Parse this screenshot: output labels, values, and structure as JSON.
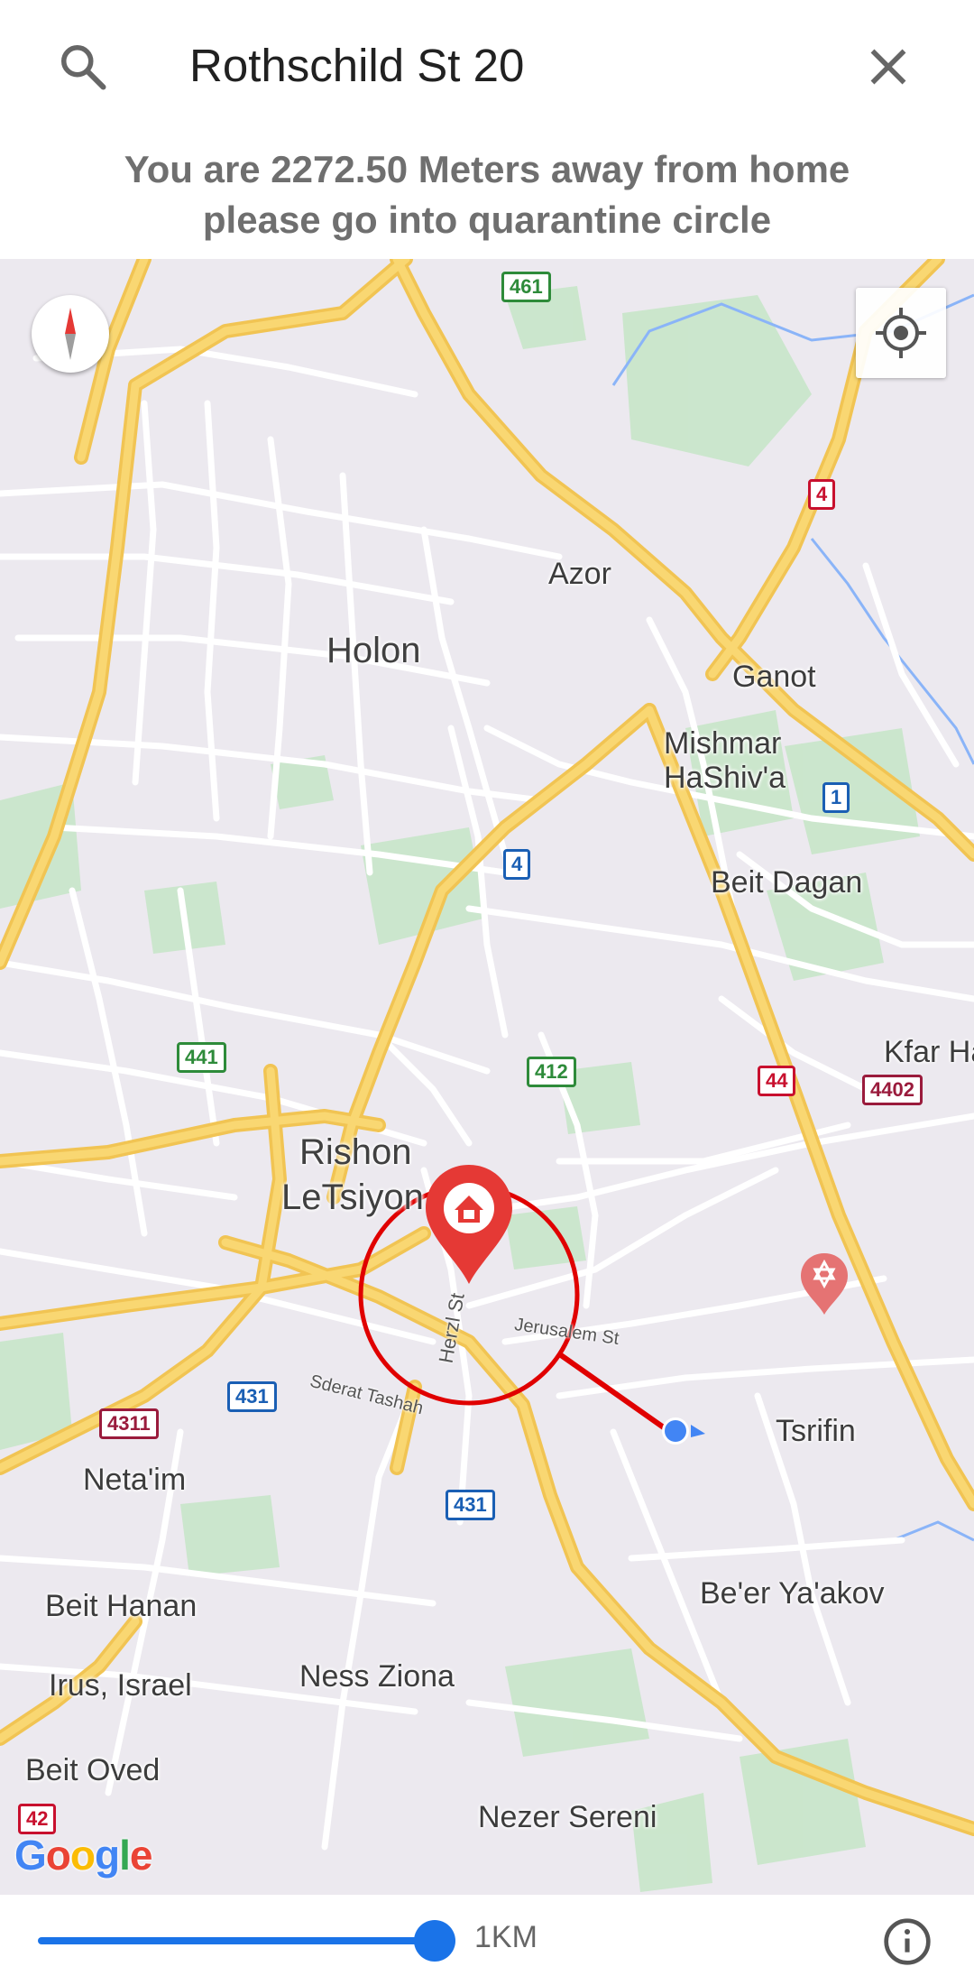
{
  "search": {
    "value": "Rothschild St 20"
  },
  "message": {
    "line1": "You are 2272.50 Meters away from home",
    "line2": "please go into quarantine circle"
  },
  "map": {
    "places": {
      "azor": "Azor",
      "holon": "Holon",
      "ganot": "Ganot",
      "mishmar1": "Mishmar",
      "mishmar2": "HaShiv'a",
      "beit_dagan": "Beit Dagan",
      "kfar": "Kfar Ha",
      "rishon1": "Rishon",
      "rishon2": "LeTsiyon",
      "tsrifin": "Tsrifin",
      "netaim": "Neta'im",
      "beer_yaakov": "Be'er Ya'akov",
      "beit_hanan": "Beit Hanan",
      "ness_ziona": "Ness Ziona",
      "irus": "Irus, Israel",
      "beit_oved": "Beit Oved",
      "nezer_sereni": "Nezer Sereni"
    },
    "streets": {
      "herzl": "Herzl St",
      "jerusalem": "Jerusalem St",
      "sderat": "Sderat Tashah"
    },
    "shields": {
      "r461": "461",
      "r4a": "4",
      "r1": "1",
      "r4b": "4",
      "r441": "441",
      "r412": "412",
      "r44": "44",
      "r4402": "4402",
      "r4311": "4311",
      "r431a": "431",
      "r431b": "431",
      "r42": "42"
    },
    "attribution": "Google"
  },
  "radius": {
    "label": "1KM",
    "value": 1.0
  },
  "colors": {
    "accent": "#1a73e8",
    "marker": "#e53935",
    "circle": "#ff0000",
    "road_major": "#f9d772",
    "park": "#c4e8c5"
  },
  "icons": {
    "search": "search-icon",
    "close": "close-icon",
    "compass": "compass-icon",
    "locate": "my-location-icon",
    "home": "home-marker-icon",
    "hospital": "star-of-david-icon",
    "info": "info-icon"
  }
}
